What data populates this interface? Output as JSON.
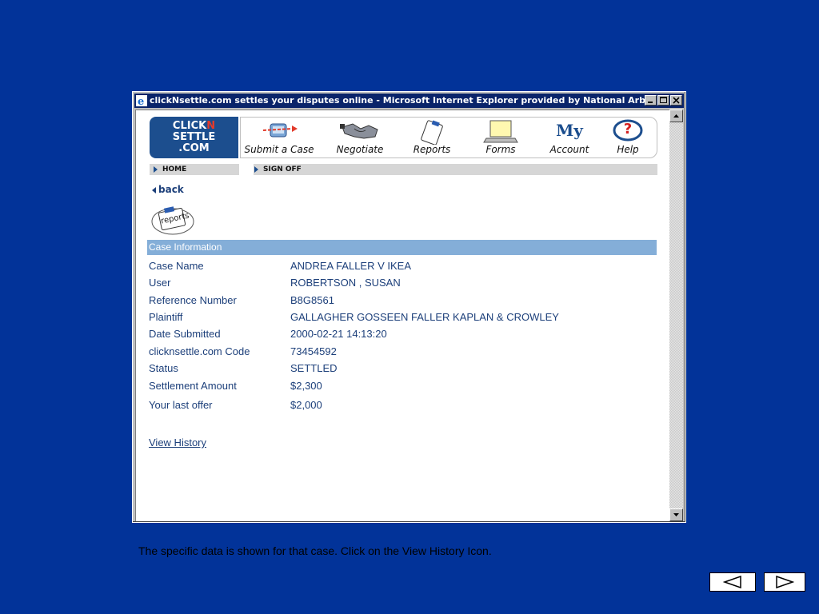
{
  "window": {
    "title": "clickNsettle.com settles your disputes online - Microsoft Internet Explorer provided by National Arb..."
  },
  "logo": {
    "line1a": "CLICK",
    "line1b": "N",
    "line2": "SETTLE",
    "line3": ".COM"
  },
  "nav": {
    "items": [
      {
        "label": "Submit a Case",
        "icon": "submit-case-icon"
      },
      {
        "label": "Negotiate",
        "icon": "handshake-icon"
      },
      {
        "label": "Reports",
        "icon": "clipboard-icon"
      },
      {
        "label": "Forms",
        "icon": "laptop-icon"
      },
      {
        "label": "Account",
        "icon_text": "My"
      },
      {
        "label": "Help",
        "icon_text": "?"
      }
    ]
  },
  "subnav": {
    "home": "HOME",
    "sign_off": "SIGN OFF"
  },
  "back_label": "back",
  "reports_icon_text": "reports",
  "section_title": "Case Information",
  "case_info": [
    {
      "label": "Case Name",
      "value": "ANDREA FALLER V IKEA"
    },
    {
      "label": "User",
      "value": "ROBERTSON , SUSAN"
    },
    {
      "label": "Reference Number",
      "value": "B8G8561"
    },
    {
      "label": "Plaintiff",
      "value": "GALLAGHER GOSSEEN FALLER KAPLAN & CROWLEY"
    },
    {
      "label": "Date Submitted",
      "value": "2000-02-21 14:13:20"
    },
    {
      "label": "clicknsettle.com Code",
      "value": "73454592"
    },
    {
      "label": "Status",
      "value": "SETTLED"
    },
    {
      "label": "Settlement Amount",
      "value": "$2,300"
    },
    {
      "label": "Your last offer",
      "value": "$2,000"
    }
  ],
  "view_history_label": "View History",
  "caption": "The specific data is shown for that case.  Click on the View History Icon.",
  "colors": {
    "background": "#023399",
    "section_bar": "#84aed8",
    "title_bar": "#0a246a",
    "text": "#1c3f7a"
  }
}
